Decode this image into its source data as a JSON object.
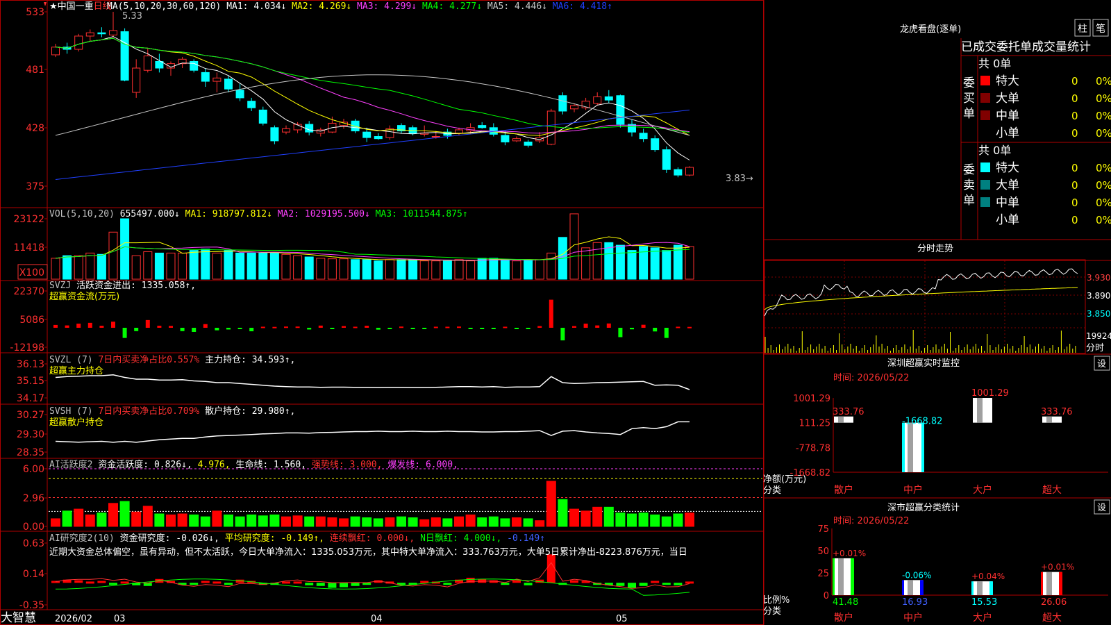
{
  "main": {
    "star": "★",
    "stock": "中国一重",
    "period": "日线",
    "legend": [
      {
        "label": "MA(5,10,20,30,60,120)",
        "c": "#ffffff"
      },
      {
        "label": "MA1: 4.034↓",
        "c": "#ffffff"
      },
      {
        "label": "MA2: 4.269↓",
        "c": "#ffff00"
      },
      {
        "label": "MA3: 4.299↓",
        "c": "#ff40ff"
      },
      {
        "label": "MA4: 4.277↓",
        "c": "#00ff00"
      },
      {
        "label": "MA5: 4.446↓",
        "c": "#c8c8c8"
      },
      {
        "label": "MA6: 4.418↑",
        "c": "#2040ff"
      }
    ],
    "y_ticks": [
      "533",
      "481",
      "428",
      "375"
    ],
    "high_label": "5.33",
    "low_label": "3.83"
  },
  "vol": {
    "legend": [
      {
        "label": "VOL(5,10,20)",
        "c": "#c0c0c0"
      },
      {
        "label": "655497.000↓",
        "c": "#ffffff"
      },
      {
        "label": "MA1: 918797.812↓",
        "c": "#ffff00"
      },
      {
        "label": "MA2: 1029195.500↓",
        "c": "#ff40ff"
      },
      {
        "label": "MA3: 1011544.875↑",
        "c": "#00ff00"
      }
    ],
    "y_ticks": [
      "23122",
      "11418"
    ],
    "unit": "X100"
  },
  "svzj": {
    "legend": [
      {
        "label": "SVZJ",
        "c": "#c0c0c0"
      },
      {
        "label": "活跃资金进出: 1335.058↑,",
        "c": "#ffffff"
      }
    ],
    "sub": "超赢资金流(万元)",
    "y_ticks": [
      "22370",
      "5086",
      "-12198"
    ]
  },
  "svzl": {
    "legend": [
      {
        "label": "SVZL (7)",
        "c": "#c0c0c0"
      },
      {
        "label": "7日内买卖净占比0.557%",
        "c": "#ff3030"
      },
      {
        "label": "主力持仓: 34.593↑,",
        "c": "#ffffff"
      }
    ],
    "sub": "超赢主力持仓",
    "y_ticks": [
      "36.13",
      "35.15",
      "34.17"
    ]
  },
  "svsh": {
    "legend": [
      {
        "label": "SVSH (7)",
        "c": "#c0c0c0"
      },
      {
        "label": "7日内买卖净占比0.709%",
        "c": "#ff3030"
      },
      {
        "label": "散户持仓: 29.980↑,",
        "c": "#ffffff"
      }
    ],
    "sub": "超赢散户持仓",
    "y_ticks": [
      "30.27",
      "29.30",
      "28.35"
    ]
  },
  "ai1": {
    "legend": [
      {
        "label": "AI活跃度2",
        "c": "#c0c0c0"
      },
      {
        "label": "资金活跃度: 0.826↓,",
        "c": "#ffffff"
      },
      {
        "label": "4.976,",
        "c": "#ffff00"
      },
      {
        "label": "生命线: 1.560,",
        "c": "#ffffff"
      },
      {
        "label": "强势线: 3.000,",
        "c": "#ff3030"
      },
      {
        "label": "爆发线: 6.000,",
        "c": "#ff40ff"
      }
    ],
    "y_ticks": [
      "6.00",
      "2.96",
      "0.00"
    ]
  },
  "ai2": {
    "legend": [
      {
        "label": "AI研究度2(10)",
        "c": "#c0c0c0"
      },
      {
        "label": "资金研究度: -0.026↓,",
        "c": "#ffffff"
      },
      {
        "label": "平均研究度: -0.149↑,",
        "c": "#ffff00"
      },
      {
        "label": "连续飘红: 0.000↓,",
        "c": "#ff3030"
      },
      {
        "label": "N日飘红: 4.000↓,",
        "c": "#00ff00"
      },
      {
        "label": "-0.149↑",
        "c": "#4060ff"
      }
    ],
    "sentence": "近期大资金总体偏空，虽有异动，但不太活跃，今日大单净流入：1335.053万元，其中特大单净流入：333.763万元，大单5日累计净出-8223.876万元，当日",
    "y_ticks": [
      "0.63",
      "0.14",
      "-0.35"
    ]
  },
  "bottom": {
    "brand": "大智慧",
    "dates": [
      "2026/02",
      "03",
      "04",
      "05"
    ]
  },
  "right": {
    "lhkp": {
      "title": "龙虎看盘(逐单)",
      "btn_bar": "柱",
      "btn_pen": "笔"
    },
    "stats": {
      "title": "已成交委托单成交量统计",
      "buy_header": "共 0单",
      "sell_header": "共 0单",
      "buy_label": "委买单",
      "sell_label": "委卖单",
      "rows": [
        "特大",
        "大单",
        "中单",
        "小单"
      ],
      "count": "0",
      "pct": "0%",
      "buy_colors": [
        "#ff0000",
        "#800000",
        "#800000",
        "#000000"
      ],
      "sell_colors": [
        "#00ffff",
        "#008080",
        "#008080",
        "#000000"
      ]
    },
    "fenshi": {
      "title": "分时走势",
      "ticks": [
        "3.930",
        "3.890",
        "3.850"
      ],
      "vol_label": "19924",
      "label": "分时"
    },
    "sz_monitor": {
      "title": "深圳超赢实时监控",
      "time": "时间: 2026/05/22",
      "set_btn": "设",
      "y_ticks": [
        "1001.29",
        "111.25",
        "-778.78",
        "-1668.82"
      ],
      "axis_label1": "净额(万元)",
      "axis_label2": "分类",
      "categories": [
        "散户",
        "中户",
        "大户",
        "超大"
      ],
      "values": [
        333.76,
        -1668.82,
        1001.29,
        333.76
      ],
      "value_labels": [
        "333.76",
        "-1668.82",
        "1001.29",
        "333.76"
      ]
    },
    "sh_stats": {
      "title": "深市超赢分类统计",
      "time": "时间: 2026/05/22",
      "set_btn": "设",
      "y_ticks": [
        "75",
        "50",
        "25",
        "0"
      ],
      "axis_label1": "比例%",
      "axis_label2": "分类",
      "categories": [
        "散户",
        "中户",
        "大户",
        "超大"
      ],
      "values": [
        41.48,
        16.93,
        15.53,
        26.06
      ],
      "value_labels": [
        "41.48",
        "16.93",
        "15.53",
        "26.06"
      ],
      "change_labels": [
        "+0.01%",
        "-0.06%",
        "+0.04%",
        "+0.01%"
      ],
      "colors": [
        "#00ff00",
        "#0000ff",
        "#00ffff",
        "#ff0000"
      ]
    }
  },
  "chart_data": [
    {
      "type": "candlestick",
      "title": "中国一重 日线",
      "x_range": [
        "2026/02",
        "2026/05"
      ],
      "ylim": [
        3.75,
        5.33
      ],
      "y_ticks": [
        5.33,
        4.81,
        4.28,
        3.75
      ],
      "series_ohlc": [
        [
          4.94,
          5.04,
          4.92,
          5.01
        ],
        [
          5.01,
          5.05,
          4.95,
          4.99
        ],
        [
          4.99,
          5.13,
          4.97,
          5.11
        ],
        [
          5.11,
          5.17,
          5.06,
          5.14
        ],
        [
          5.14,
          5.19,
          5.1,
          5.13
        ],
        [
          5.12,
          5.33,
          5.1,
          5.16
        ],
        [
          5.15,
          5.18,
          4.7,
          4.71
        ],
        [
          4.6,
          4.9,
          4.55,
          4.82
        ],
        [
          4.8,
          5.0,
          4.78,
          4.93
        ],
        [
          4.88,
          4.95,
          4.78,
          4.82
        ],
        [
          4.82,
          4.88,
          4.75,
          4.86
        ],
        [
          4.86,
          4.92,
          4.82,
          4.9
        ],
        [
          4.88,
          4.9,
          4.78,
          4.8
        ],
        [
          4.78,
          4.82,
          4.65,
          4.7
        ],
        [
          4.7,
          4.78,
          4.6,
          4.73
        ],
        [
          4.72,
          4.75,
          4.6,
          4.63
        ],
        [
          4.62,
          4.68,
          4.52,
          4.55
        ],
        [
          4.52,
          4.55,
          4.43,
          4.46
        ],
        [
          4.44,
          4.47,
          4.3,
          4.32
        ],
        [
          4.28,
          4.3,
          4.13,
          4.16
        ],
        [
          4.24,
          4.3,
          4.22,
          4.27
        ],
        [
          4.26,
          4.33,
          4.23,
          4.31
        ],
        [
          4.31,
          4.34,
          4.21,
          4.24
        ],
        [
          4.23,
          4.28,
          4.2,
          4.26
        ],
        [
          4.24,
          4.38,
          4.23,
          4.32
        ],
        [
          4.3,
          4.36,
          4.27,
          4.33
        ],
        [
          4.34,
          4.36,
          4.23,
          4.25
        ],
        [
          4.24,
          4.28,
          4.15,
          4.19
        ],
        [
          4.2,
          4.23,
          4.17,
          4.18
        ],
        [
          4.19,
          4.3,
          4.17,
          4.27
        ],
        [
          4.3,
          4.32,
          4.23,
          4.25
        ],
        [
          4.28,
          4.3,
          4.21,
          4.23
        ],
        [
          4.22,
          4.3,
          4.2,
          4.23
        ],
        [
          4.2,
          4.25,
          4.18,
          4.2
        ],
        [
          4.24,
          4.27,
          4.18,
          4.21
        ],
        [
          4.23,
          4.28,
          4.21,
          4.26
        ],
        [
          4.25,
          4.32,
          4.22,
          4.28
        ],
        [
          4.3,
          4.33,
          4.27,
          4.28
        ],
        [
          4.28,
          4.32,
          4.2,
          4.22
        ],
        [
          4.21,
          4.25,
          4.12,
          4.15
        ],
        [
          4.16,
          4.2,
          4.15,
          4.18
        ],
        [
          4.15,
          4.17,
          4.1,
          4.12
        ],
        [
          4.16,
          4.24,
          4.14,
          4.19
        ],
        [
          4.13,
          4.45,
          4.12,
          4.43
        ],
        [
          4.57,
          4.6,
          4.4,
          4.43
        ],
        [
          4.45,
          4.5,
          4.42,
          4.48
        ],
        [
          4.46,
          4.55,
          4.44,
          4.52
        ],
        [
          4.5,
          4.6,
          4.48,
          4.56
        ],
        [
          4.56,
          4.62,
          4.5,
          4.53
        ],
        [
          4.57,
          4.58,
          4.28,
          4.31
        ],
        [
          4.31,
          4.35,
          4.2,
          4.24
        ],
        [
          4.23,
          4.27,
          4.15,
          4.18
        ],
        [
          4.18,
          4.21,
          4.06,
          4.08
        ],
        [
          4.08,
          4.11,
          3.87,
          3.9
        ],
        [
          3.9,
          3.92,
          3.83,
          3.85
        ],
        [
          3.85,
          3.93,
          3.84,
          3.92
        ]
      ]
    },
    {
      "type": "bar",
      "title": "VOL(5,10,20)",
      "ylim": [
        0,
        23122
      ],
      "values": [
        8000,
        9000,
        9000,
        10000,
        9500,
        18000,
        23122,
        9000,
        10500,
        10000,
        10000,
        10000,
        11000,
        11500,
        10000,
        11000,
        10000,
        10000,
        10000,
        10200,
        9500,
        9000,
        8500,
        8000,
        7800,
        7800,
        7500,
        7500,
        7000,
        7500,
        7500,
        7500,
        7000,
        7000,
        7000,
        7500,
        7000,
        8000,
        8000,
        7500,
        7000,
        7200,
        7500,
        10000,
        16000,
        25000,
        12000,
        14000,
        14000,
        13000,
        11000,
        12500,
        12000,
        11000,
        13000,
        12500,
        12000,
        10000
      ]
    },
    {
      "type": "bar",
      "title": "超赢资金流(万元)",
      "ylim": [
        -12198,
        22370
      ],
      "values": [
        1500,
        1200,
        2300,
        2800,
        1000,
        3500,
        -6500,
        -2300,
        4500,
        1000,
        900,
        -2300,
        -2800,
        2000,
        -1800,
        -1300,
        -1100,
        -2400,
        400,
        300,
        500,
        500,
        -1300,
        1100,
        -800,
        800,
        400,
        1000,
        -1400,
        -800,
        500,
        -600,
        -600,
        400,
        400,
        500,
        -900,
        -500,
        -500,
        400,
        -400,
        -500,
        800,
        17000,
        -8000,
        800,
        2300,
        1200,
        2400,
        -6000,
        -1200,
        1600,
        -2500,
        -6500,
        400,
        300,
        400,
        500
      ]
    },
    {
      "type": "line",
      "title": "超赢主力持仓",
      "ylim": [
        34.17,
        36.13
      ],
      "values": [
        35.35,
        35.4,
        35.42,
        35.45,
        35.45,
        35.5,
        35.35,
        35.25,
        35.25,
        35.2,
        35.2,
        35.22,
        35.15,
        35.12,
        35.05,
        35.05,
        35.0,
        34.95,
        34.9,
        34.85,
        34.82,
        34.8,
        34.8,
        34.78,
        34.79,
        34.79,
        34.78,
        34.78,
        34.77,
        34.78,
        34.78,
        34.77,
        34.77,
        34.78,
        34.8,
        34.82,
        34.82,
        34.8,
        34.82,
        34.78,
        34.8,
        34.8,
        34.82,
        35.4,
        35.05,
        35.0,
        35.02,
        35.05,
        35.06,
        35.08,
        35.1,
        35.12,
        34.9,
        34.92,
        34.9,
        34.65,
        34.66,
        34.66
      ]
    },
    {
      "type": "line",
      "title": "超赢散户持仓",
      "ylim": [
        28.35,
        30.27
      ],
      "values": [
        28.9,
        28.88,
        28.86,
        28.88,
        28.9,
        28.85,
        28.9,
        28.85,
        28.92,
        28.98,
        29.02,
        29.05,
        29.05,
        29.12,
        29.18,
        29.2,
        29.22,
        29.25,
        29.28,
        29.3,
        29.33,
        29.33,
        29.32,
        29.35,
        29.36,
        29.38,
        29.4,
        29.4,
        29.42,
        29.4,
        29.4,
        29.42,
        29.4,
        29.4,
        29.42,
        29.4,
        29.4,
        29.38,
        29.38,
        29.4,
        29.4,
        29.42,
        29.45,
        29.2,
        29.42,
        29.45,
        29.38,
        29.33,
        29.3,
        29.25,
        29.55,
        29.6,
        29.55,
        29.65,
        29.9,
        29.9,
        29.9,
        29.9
      ]
    },
    {
      "type": "bar",
      "title": "资金活跃度",
      "ylim": [
        0,
        6.0
      ],
      "values": [
        0.8,
        1.6,
        1.8,
        1.2,
        1.4,
        2.4,
        2.6,
        1.5,
        2.1,
        1.3,
        1.2,
        1.3,
        1.2,
        1.0,
        1.6,
        1.2,
        1.0,
        1.2,
        1.1,
        1.2,
        1.0,
        1.1,
        1.0,
        1.0,
        0.9,
        0.8,
        1.0,
        0.9,
        0.8,
        0.9,
        1.0,
        0.9,
        0.7,
        0.9,
        0.8,
        1.0,
        1.2,
        0.9,
        1.0,
        0.8,
        0.9,
        0.8,
        0.6,
        4.7,
        2.8,
        1.8,
        1.6,
        2.0,
        2.0,
        1.4,
        1.3,
        1.4,
        1.2,
        1.0,
        1.3,
        1.4,
        1.4,
        0.9
      ]
    },
    {
      "type": "bar",
      "title": "资金研究度",
      "ylim": [
        -0.35,
        0.63
      ],
      "values": [
        0.03,
        0.05,
        0.04,
        0.02,
        0.03,
        -0.02,
        0.02,
        -0.04,
        -0.05,
        0.06,
        0.03,
        -0.02,
        -0.03,
        0.03,
        0.02,
        -0.02,
        0.05,
        0.03,
        -0.02,
        -0.01,
        0.02,
        0.02,
        -0.04,
        -0.05,
        -0.08,
        -0.07,
        -0.05,
        -0.03,
        0.04,
        0.02,
        -0.02,
        -0.02,
        0.03,
        0.02,
        -0.03,
        0.05,
        0.08,
        0.06,
        0.04,
        -0.03,
        0.04,
        -0.04,
        0.05,
        0.45,
        -0.03,
        0.04,
        0.03,
        -0.02,
        -0.04,
        -0.05,
        -0.08,
        -0.05,
        0.03,
        -0.03,
        -0.04,
        0.02,
        -0.02,
        -0.03
      ]
    },
    {
      "type": "bar",
      "title": "深圳超赢实时监控",
      "categories": [
        "散户",
        "中户",
        "大户",
        "超大"
      ],
      "values": [
        333.76,
        -1668.82,
        1001.29,
        333.76
      ],
      "ylim": [
        -1668.82,
        1001.29
      ]
    },
    {
      "type": "bar",
      "title": "深市超赢分类统计",
      "categories": [
        "散户",
        "中户",
        "大户",
        "超大"
      ],
      "values": [
        41.48,
        16.93,
        15.53,
        26.06
      ],
      "ylim": [
        0,
        75
      ]
    }
  ]
}
